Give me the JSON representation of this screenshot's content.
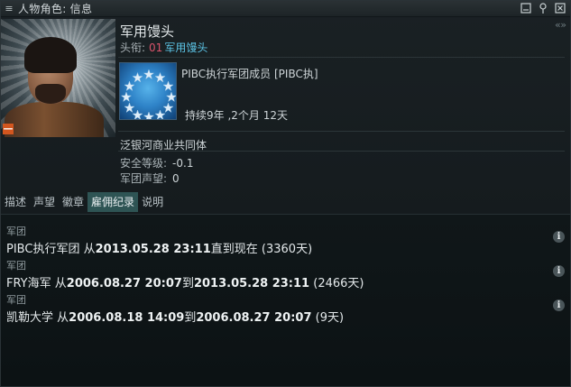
{
  "window": {
    "title": "人物角色: 信息",
    "menu_icon": "hamburger-icon",
    "controls": [
      "minimize-icon",
      "pin-icon",
      "close-icon"
    ],
    "collapse_icon": "double-chevron-icon",
    "collapse_glyph": "«  »"
  },
  "character": {
    "name": "军用馒头",
    "title_label": "头衔:",
    "title_number": "01",
    "title_value": "军用馒头",
    "portrait_badge": "—"
  },
  "corporation": {
    "name": "PIBC执行军团成员 [PIBC执]",
    "duration": "持续9年 ,2个月 12天",
    "logo_icon": "corp-stars-logo"
  },
  "alliance": {
    "name": "泛银河商业共同体"
  },
  "stats": [
    {
      "label": "安全等级:",
      "value": "-0.1"
    },
    {
      "label": "军团声望:",
      "value": "0"
    }
  ],
  "tabs": [
    {
      "label": "描述",
      "active": false
    },
    {
      "label": "声望",
      "active": false
    },
    {
      "label": "徽章",
      "active": false
    },
    {
      "label": "雇佣纪录",
      "active": true
    },
    {
      "label": "说明",
      "active": false
    }
  ],
  "history": [
    {
      "label": "军团",
      "corp": "PIBC执行军团",
      "from_word": "从",
      "start": "2013.05.28 23:11",
      "to_word": "直到现在",
      "end": "",
      "days": "(3360天)"
    },
    {
      "label": "军团",
      "corp": "FRY海军",
      "from_word": "从",
      "start": "2006.08.27 20:07",
      "to_word": "到",
      "end": "2013.05.28 23:11",
      "days": "(2466天)"
    },
    {
      "label": "军团",
      "corp": "凯勒大学",
      "from_word": "从",
      "start": "2006.08.18 14:09",
      "to_word": "到",
      "end": "2006.08.27 20:07",
      "days": "(9天)"
    }
  ],
  "info_icon_glyph": "i"
}
